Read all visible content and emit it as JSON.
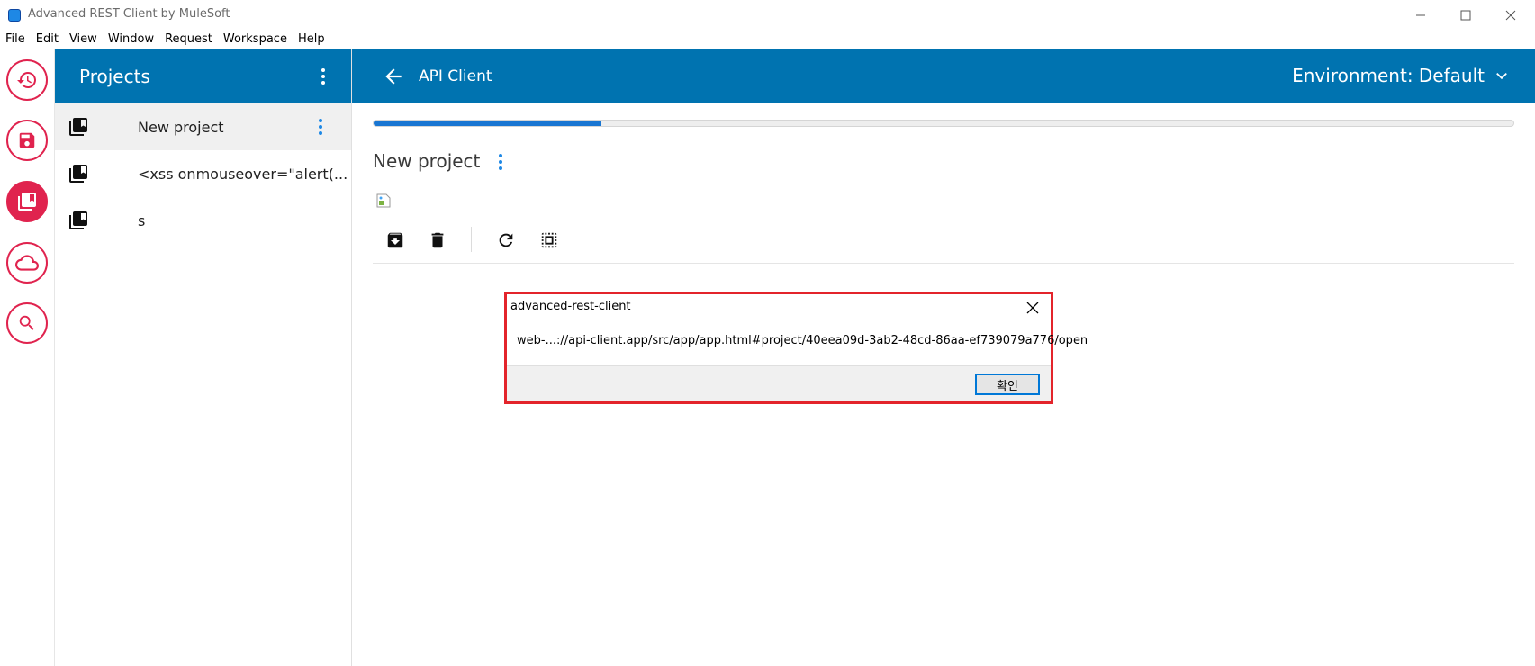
{
  "window": {
    "title": "Advanced REST Client by MuleSoft",
    "icon": "arc-cloud-icon"
  },
  "menu": [
    "File",
    "Edit",
    "View",
    "Window",
    "Request",
    "Workspace",
    "Help"
  ],
  "rail": [
    {
      "icon": "history-icon",
      "active": false
    },
    {
      "icon": "save-icon",
      "active": false
    },
    {
      "icon": "projects-icon",
      "active": true
    },
    {
      "icon": "cloud-icon",
      "active": false
    },
    {
      "icon": "search-icon",
      "active": false
    }
  ],
  "projects": {
    "title": "Projects",
    "items": [
      {
        "label": "New project",
        "selected": true
      },
      {
        "label": "<xss onmouseover=\"alert(...",
        "selected": false
      },
      {
        "label": "s",
        "selected": false
      }
    ]
  },
  "header": {
    "title": "API Client",
    "environment": "Environment: Default"
  },
  "content": {
    "progress": 0.2,
    "title": "New project"
  },
  "toolbar": [
    "archive-icon",
    "delete-icon",
    "refresh-icon",
    "select-all-icon"
  ],
  "dialog": {
    "title": "advanced-rest-client",
    "message": "web-...://api-client.app/src/app/app.html#project/40eea09d-3ab2-48cd-86aa-ef739079a776/open",
    "ok_label": "확인"
  },
  "colors": {
    "brand": "#0073b0",
    "accent": "#e0234e",
    "progress": "#1976d2",
    "highlight": "#e3242b"
  }
}
